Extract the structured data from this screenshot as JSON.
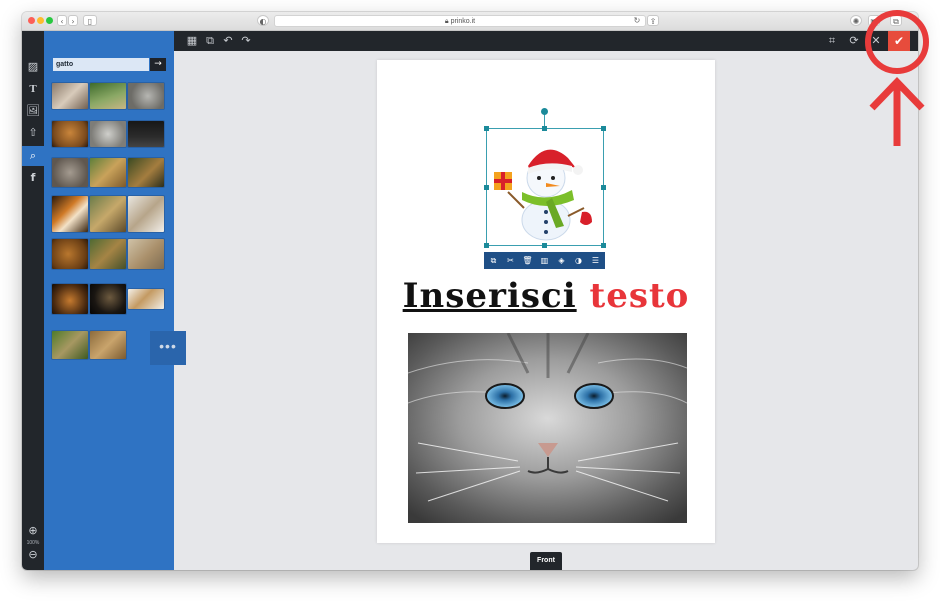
{
  "browser": {
    "url": "prinko.it",
    "traffic_lights": [
      "#fc5f57",
      "#fdbc2e",
      "#28c840"
    ]
  },
  "toolbar": {
    "left_icons": [
      "layout-icon",
      "duplicate-icon",
      "undo-icon",
      "redo-icon"
    ],
    "right_icons": [
      "crop-icon",
      "refresh-icon",
      "close-icon"
    ],
    "confirm_icon": "checkmark-icon",
    "confirm_color": "#e74c3c"
  },
  "rail": {
    "items": [
      "pattern-icon",
      "text-icon",
      "image-icon",
      "upload-icon",
      "search-icon",
      "facebook-icon"
    ],
    "active": "search-icon",
    "zoom_level": "100%"
  },
  "search": {
    "query": "gatto",
    "go_label": "→",
    "more_label": "•••"
  },
  "canvas": {
    "text_word1": "Inserisci",
    "text_word2": "testo",
    "text_color1": "#111111",
    "text_color2": "#e8353a",
    "context_tools": [
      "copy-icon",
      "cut-icon",
      "delete-icon",
      "chart-icon",
      "layers-icon",
      "contrast-icon",
      "adjust-icon"
    ]
  },
  "side_tab": {
    "label": "Front"
  },
  "annotation": {
    "color": "#e83b3b"
  }
}
